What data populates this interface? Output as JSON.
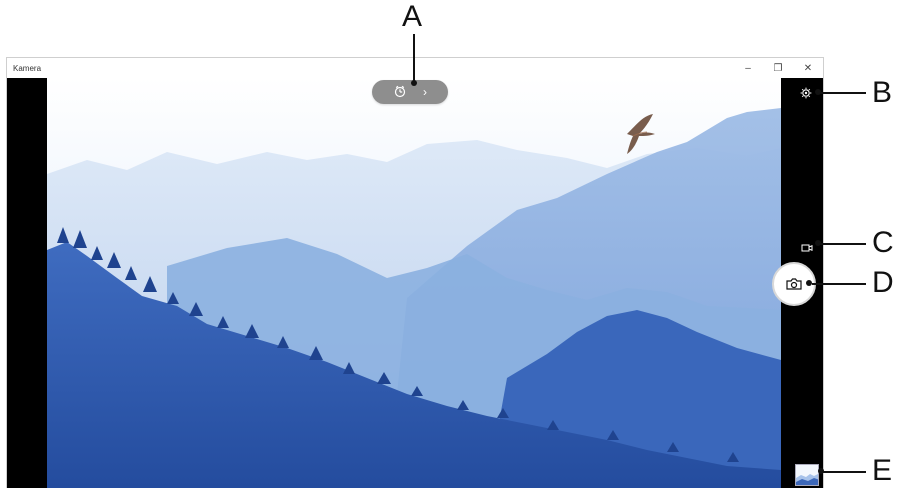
{
  "window": {
    "title": "Kamera",
    "minimize_icon": "minimize-icon",
    "restore_icon": "restore-icon",
    "close_icon": "close-icon"
  },
  "controls": {
    "timer_icon": "timer-icon",
    "timer_expand_icon": "chevron-right-icon",
    "settings_icon": "settings-gear-icon",
    "video_mode_icon": "video-camera-icon",
    "shutter_icon": "camera-shutter-icon",
    "gallery_thumbnail": "photo-thumbnail"
  },
  "callouts": {
    "a": "A",
    "b": "B",
    "c": "C",
    "d": "D",
    "e": "E"
  },
  "glyphs": {
    "minimize": "–",
    "restore": "❐",
    "close": "✕",
    "chevron": "›"
  },
  "colors": {
    "pill_bg": "#8e8e8e",
    "sky_light": "#eef4fb",
    "mountain_far": "#c7daf0",
    "mountain_mid": "#8fb0de",
    "mountain_near": "#2f5bb0",
    "forest_dark": "#1c3f93"
  }
}
